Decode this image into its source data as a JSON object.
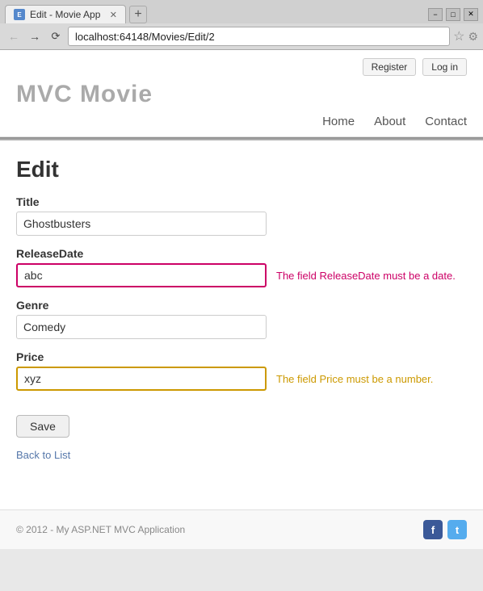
{
  "browser": {
    "tab_title": "Edit - Movie App",
    "new_tab_icon": "+",
    "address": "localhost:64148/Movies/Edit/2",
    "favicon_label": "E",
    "window_controls": [
      "−",
      "□",
      "✕"
    ]
  },
  "header": {
    "register_label": "Register",
    "login_label": "Log in",
    "site_title": "MVC Movie",
    "nav": {
      "home": "Home",
      "about": "About",
      "contact": "Contact"
    }
  },
  "form": {
    "heading": "Edit",
    "title_label": "Title",
    "title_value": "Ghostbusters",
    "release_date_label": "ReleaseDate",
    "release_date_value": "abc",
    "release_date_error": "The field ReleaseDate must be a date.",
    "genre_label": "Genre",
    "genre_value": "Comedy",
    "price_label": "Price",
    "price_value": "xyz",
    "price_error": "The field Price must be a number.",
    "save_label": "Save",
    "back_link": "Back to List"
  },
  "footer": {
    "copyright": "© 2012 - My ASP.NET MVC Application",
    "facebook_label": "f",
    "twitter_label": "t"
  }
}
